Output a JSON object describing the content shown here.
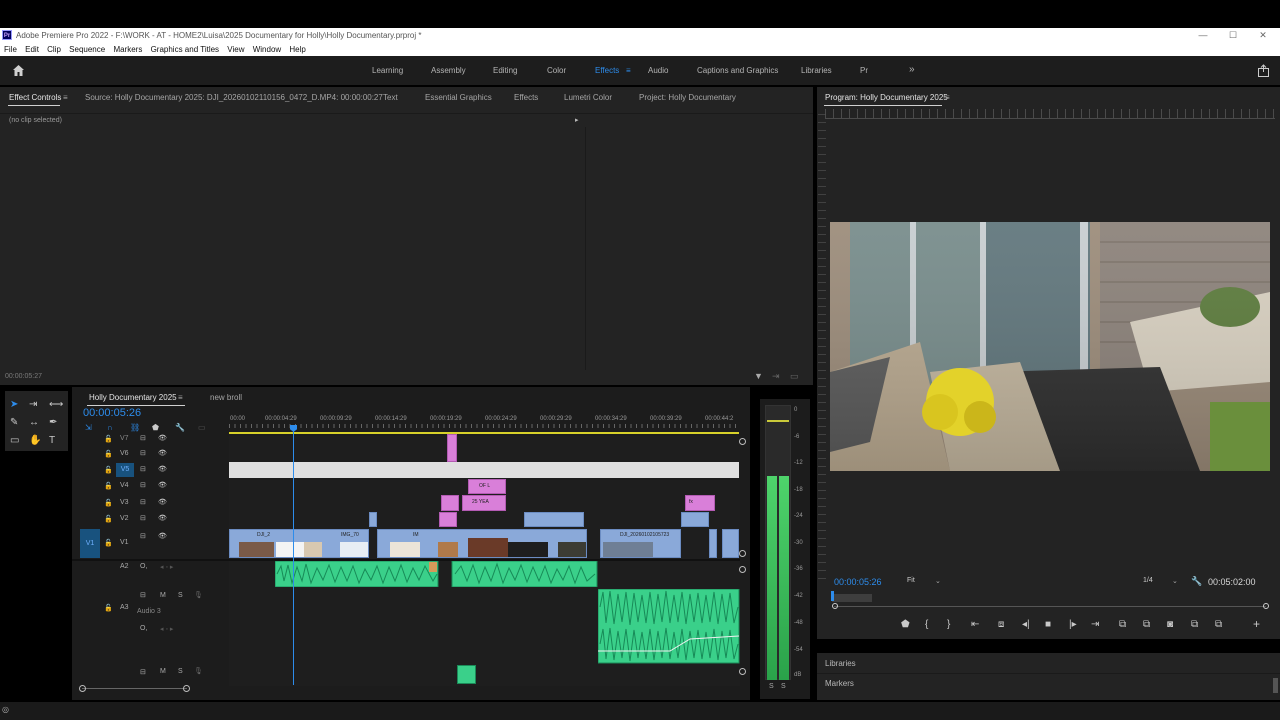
{
  "title_bar": {
    "app_icon": "Pr",
    "title": "Adobe Premiere Pro 2022 - F:\\WORK - AT - HOME2\\Luisa\\2025 Documentary for Holly\\Holly Documentary.prproj *",
    "minimize": "—",
    "maximize": "☐",
    "close": "✕"
  },
  "menu": [
    "File",
    "Edit",
    "Clip",
    "Sequence",
    "Markers",
    "Graphics and Titles",
    "View",
    "Window",
    "Help"
  ],
  "workspaces": {
    "tabs": [
      "Learning",
      "Assembly",
      "Editing",
      "Color",
      "Effects",
      "Audio",
      "Captions and Graphics",
      "Libraries",
      "Pr"
    ],
    "active": "Effects",
    "overflow": "»",
    "menu_icon": "≡"
  },
  "source_panel": {
    "tabs": [
      "Effect Controls",
      "Source: Holly Documentary 2025: DJI_20260102110156_0472_D.MP4: 00:00:00:27",
      "Text",
      "Essential Graphics",
      "Effects",
      "Lumetri Color",
      "Project: Holly Documentary"
    ],
    "active_tab": "Effect Controls",
    "tab_menu": "≡",
    "no_clip": "(no clip selected)",
    "timecode": "00:00:05:27"
  },
  "program_monitor": {
    "title": "Program: Holly Documentary 2025",
    "title_menu": "≡",
    "timecode": "00:00:05:26",
    "fit": "Fit",
    "resolution": "1/4",
    "duration": "00:05:02:00"
  },
  "timeline": {
    "tabs": [
      "Holly Documentary 2025",
      "new broll"
    ],
    "active_tab": "Holly Documentary 2025",
    "tab_menu": "≡",
    "timecode": "00:00:05:26",
    "ruler": [
      "00:00",
      "00:00:04:29",
      "00:00:09:29",
      "00:00:14:29",
      "00:00:19:29",
      "00:00:24:29",
      "00:00:29:29",
      "00:00:34:29",
      "00:00:39:29",
      "00:00:44:2"
    ],
    "video_tracks": [
      "V7",
      "V6",
      "V5",
      "V4",
      "V3",
      "V2",
      "V1"
    ],
    "audio_tracks": [
      "A2",
      "A3"
    ],
    "v1_source": "V1",
    "audio3_name": "Audio 3",
    "track_letters": {
      "mute": "M",
      "solo": "S",
      "opacity": "O,"
    },
    "clip_labels": {
      "dji2": "DJI_2",
      "img70": "IMG_70",
      "im": "IM",
      "dji_long": "DJI_20260102105723",
      "ofl": "OF L",
      "yea": "25 YEA"
    },
    "clip_badge": "fx"
  },
  "audio_meter": {
    "scale": [
      "0",
      "-6",
      "-12",
      "-18",
      "-24",
      "-30",
      "-36",
      "-42",
      "-48",
      "-54",
      "dB"
    ],
    "solo": [
      "S",
      "S"
    ],
    "level_fraction": 0.74
  },
  "right_panels": [
    "Libraries",
    "Markers"
  ],
  "colors": {
    "accent": "#2d8ceb",
    "video_clip": "#8aa9d9",
    "title_clip": "#d97fd9",
    "audio_clip": "#3ad08a"
  }
}
